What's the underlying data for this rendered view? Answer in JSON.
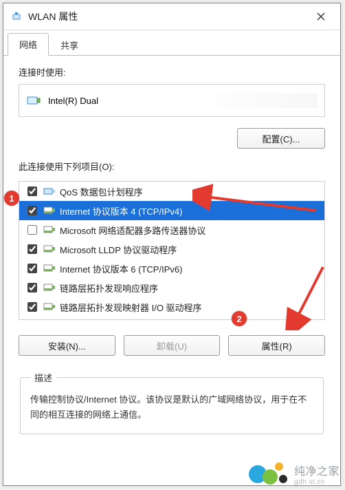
{
  "window": {
    "title": "WLAN 属性"
  },
  "tabs": {
    "network": "网络",
    "sharing": "共享"
  },
  "connect_using_label": "连接时使用:",
  "adapter_name": "Intel(R) Dual",
  "configure_button": "配置(C)...",
  "items_label": "此连接使用下列项目(O):",
  "items": [
    {
      "checked": true,
      "label": "QoS 数据包计划程序",
      "kind": "qos"
    },
    {
      "checked": true,
      "label": "Internet 协议版本 4 (TCP/IPv4)",
      "kind": "proto",
      "selected": true
    },
    {
      "checked": false,
      "label": "Microsoft 网络适配器多路传送器协议",
      "kind": "proto"
    },
    {
      "checked": true,
      "label": "Microsoft LLDP 协议驱动程序",
      "kind": "proto"
    },
    {
      "checked": true,
      "label": "Internet 协议版本 6 (TCP/IPv6)",
      "kind": "proto"
    },
    {
      "checked": true,
      "label": "链路层拓扑发现响应程序",
      "kind": "proto"
    },
    {
      "checked": true,
      "label": "链路层拓扑发现映射器 I/O 驱动程序",
      "kind": "proto"
    }
  ],
  "buttons": {
    "install": "安装(N)...",
    "uninstall": "卸载(U)",
    "properties": "属性(R)"
  },
  "description": {
    "legend": "描述",
    "text": "传输控制协议/Internet 协议。该协议是默认的广域网络协议，用于在不同的相互连接的网络上通信。"
  },
  "annotations": {
    "marker1": "1",
    "marker2": "2"
  },
  "watermark": {
    "name": "纯净之家",
    "url": "gdh st.cn"
  }
}
